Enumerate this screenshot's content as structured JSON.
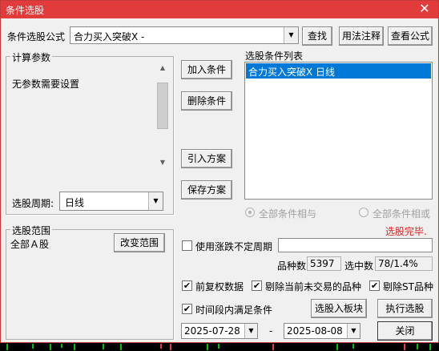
{
  "window": {
    "title": "条件选股",
    "close_glyph": "✕"
  },
  "formula": {
    "label": "条件选股公式",
    "value": "合力买入突破X - ",
    "find_btn": "查找",
    "usage_btn": "用法注释",
    "view_btn": "查看公式"
  },
  "params": {
    "group_title": "计算参数",
    "text": "无参数需要设置",
    "period_label": "选股周期:",
    "period_value": "日线"
  },
  "actions": {
    "add": "加入条件",
    "delete": "删除条件",
    "import": "引入方案",
    "save": "保存方案"
  },
  "condition_list": {
    "title": "选股条件列表",
    "items": [
      "合力买入突破X  日线"
    ]
  },
  "logic": {
    "all_and": "全部条件相与",
    "all_or": "全部条件相或"
  },
  "status": {
    "text": "选股完毕.",
    "color": "#e02020"
  },
  "range": {
    "group_title": "选股范围",
    "value": "全部Ａ股",
    "change_btn": "改变范围"
  },
  "uncertain_period": {
    "label": "使用涨跌不定周期",
    "checked": false
  },
  "stats": {
    "count_label": "品种数",
    "count_value": "5397",
    "hit_label": "选中数",
    "hit_value": "78/1.4%"
  },
  "options": {
    "forward_adjust": {
      "label": "前复权数据",
      "checked": true
    },
    "exclude_untraded": {
      "label": "剔除当前未交易的品种",
      "checked": true
    },
    "exclude_st": {
      "label": "剔除ST品种",
      "checked": true
    },
    "period_condition": {
      "label": "时间段内满足条件",
      "checked": true
    }
  },
  "date_range": {
    "start": "2025-07-28",
    "separator": "-",
    "end": "2025-08-08"
  },
  "buttons": {
    "to_block": "选股入板块",
    "execute": "执行选股",
    "close": "关闭"
  },
  "glyphs": {
    "check": "✔",
    "combo_arrow": "▼",
    "scroll_up": "▲",
    "scroll_down": "▼"
  }
}
